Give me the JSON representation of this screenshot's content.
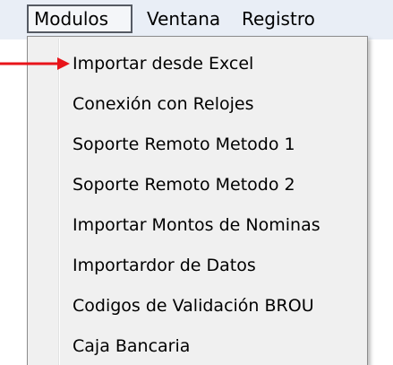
{
  "menubar": {
    "items": [
      {
        "label": "Modulos"
      },
      {
        "label": "Ventana"
      },
      {
        "label": "Registro"
      }
    ]
  },
  "dropdown": {
    "items": [
      {
        "label": "Importar desde Excel"
      },
      {
        "label": "Conexión con Relojes"
      },
      {
        "label": "Soporte Remoto Metodo 1"
      },
      {
        "label": "Soporte Remoto Metodo 2"
      },
      {
        "label": "Importar Montos de Nominas"
      },
      {
        "label": "Importardor de Datos"
      },
      {
        "label": "Codigos de Validación BROU"
      },
      {
        "label": "Caja Bancaria"
      }
    ]
  },
  "colors": {
    "arrow": "#e8141a",
    "menubar_bg": "#e9eef6",
    "menu_bg": "#f0f0f0"
  },
  "annotation": {
    "icon": "red-arrow-icon"
  }
}
